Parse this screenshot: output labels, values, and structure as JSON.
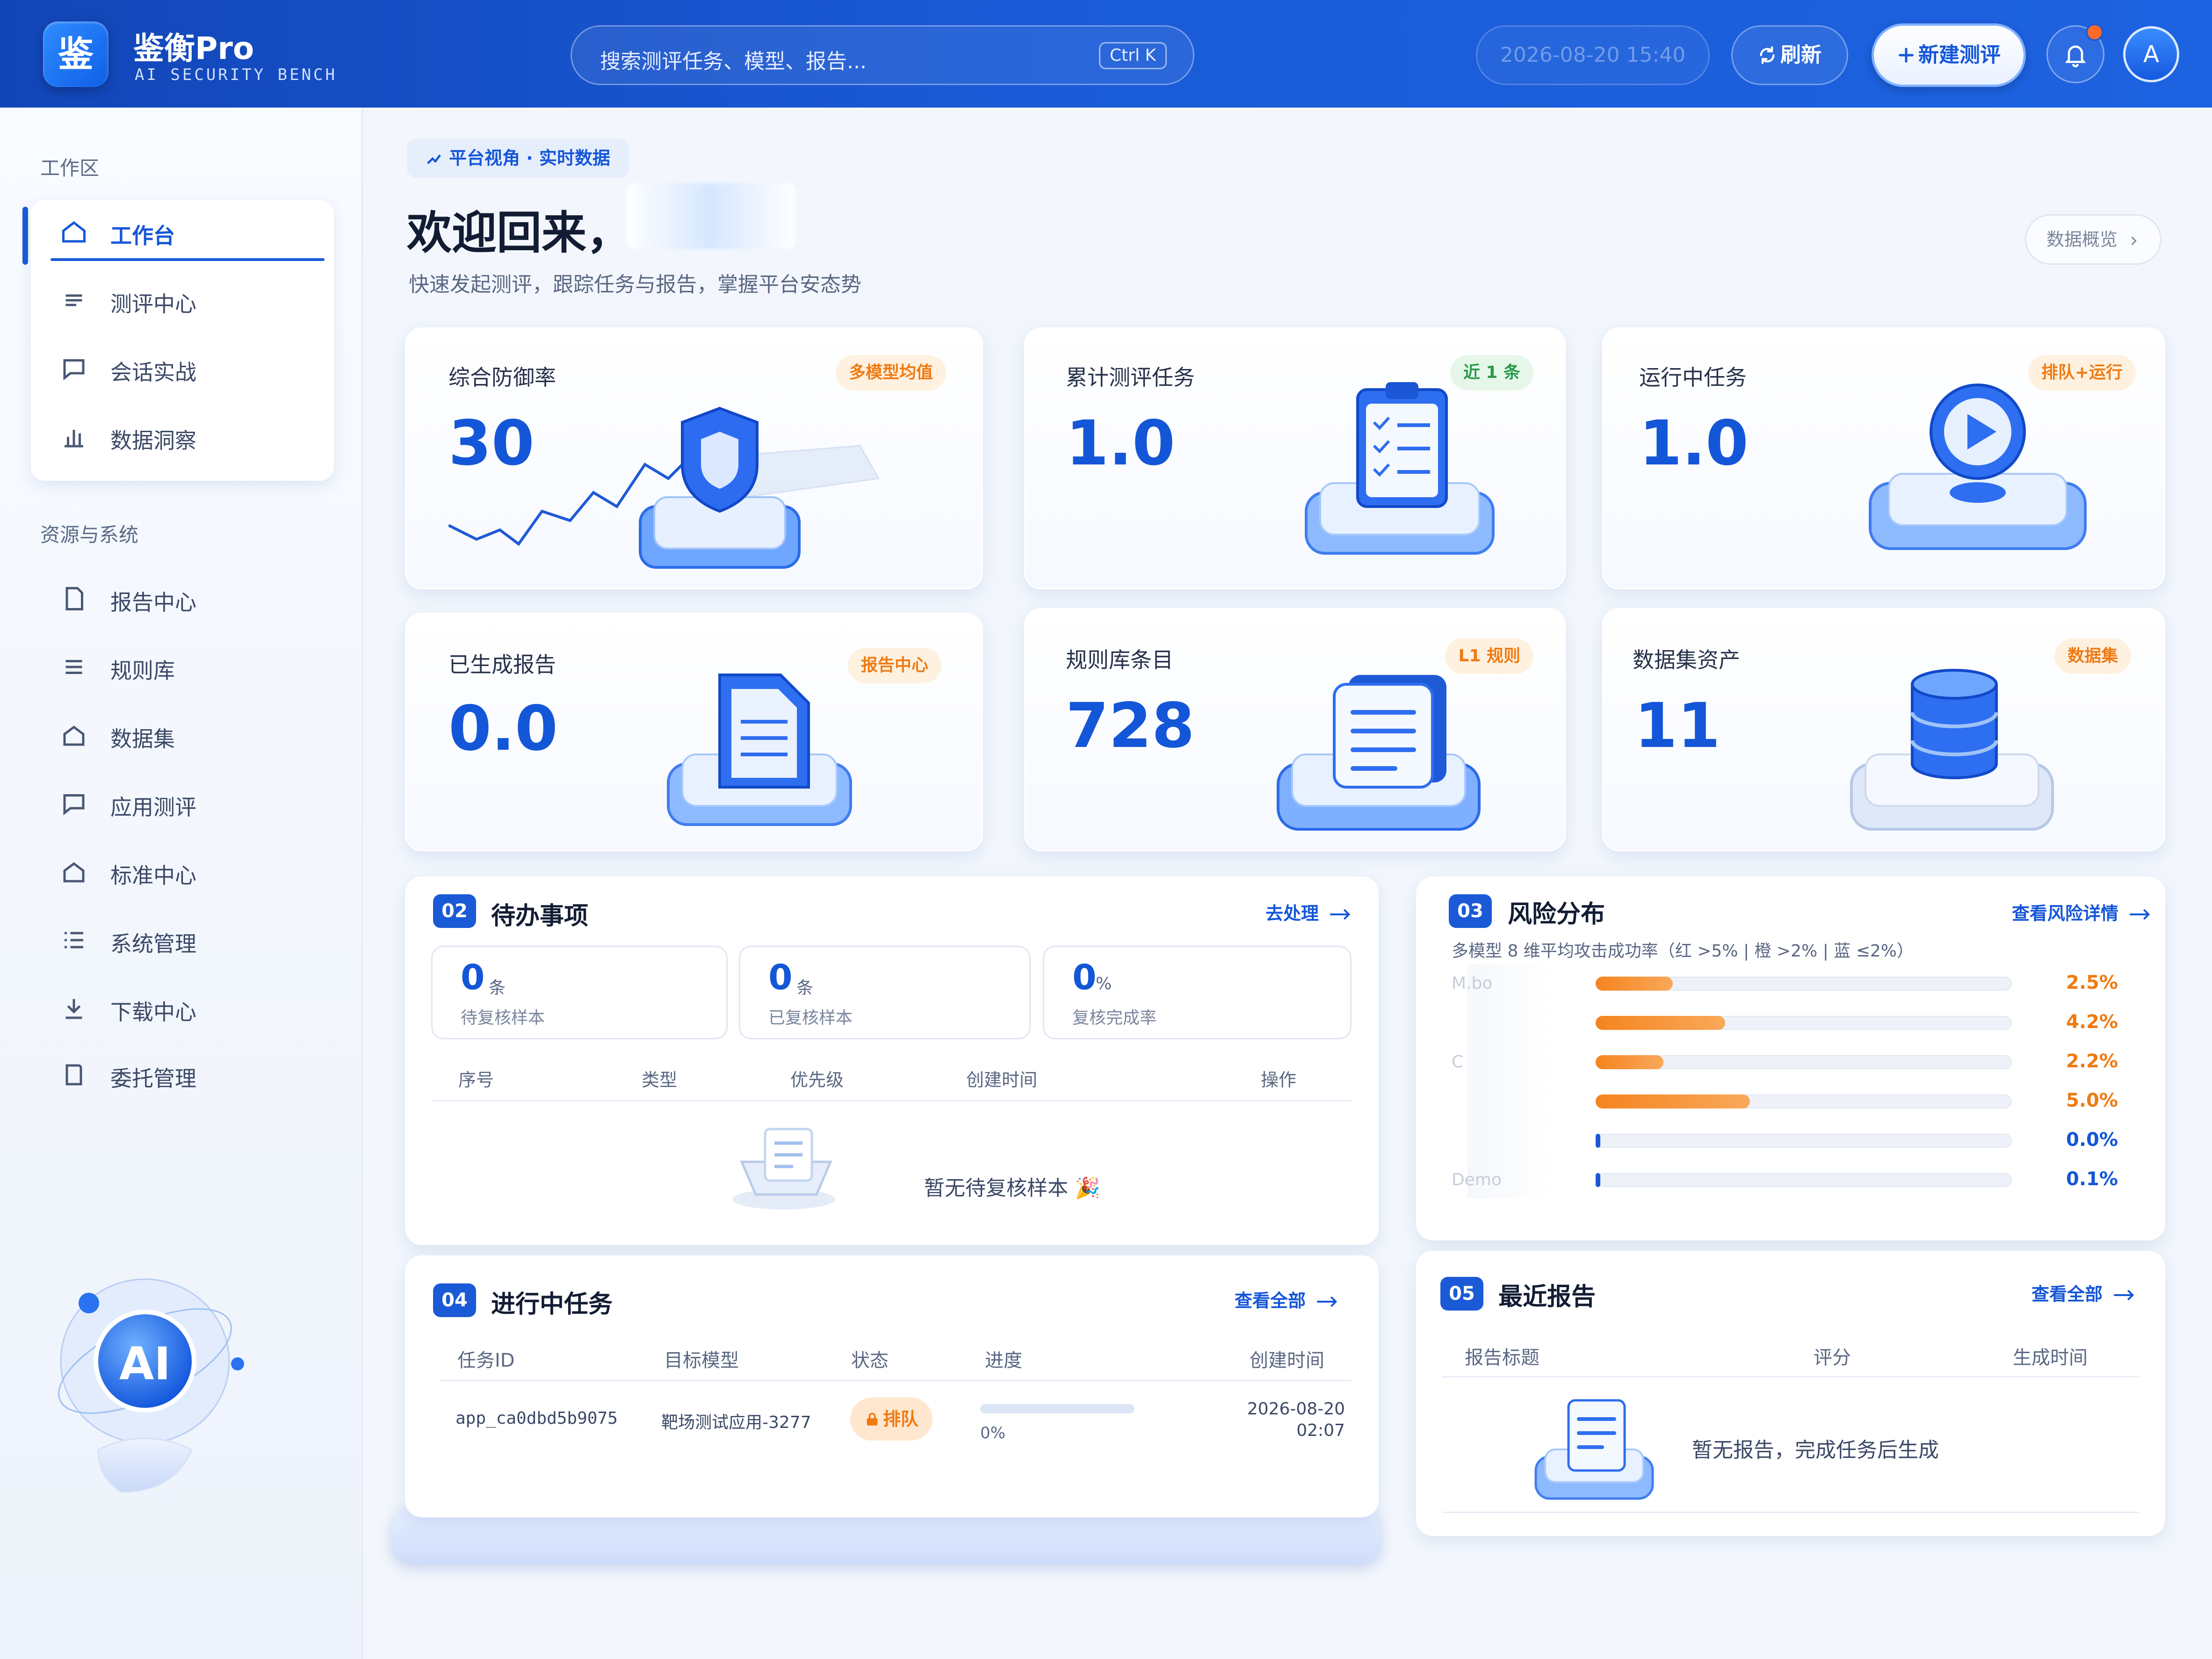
{
  "header": {
    "logo_char": "鉴",
    "brand": "鉴衡Pro",
    "brand_sub": "AI SECURITY BENCH",
    "search_placeholder": "搜索测评任务、模型、报告...",
    "search_shortcut": "Ctrl K",
    "datetime": "2026-08-20  15:40",
    "refresh_label": "刷新",
    "new_eval_label": "新建测评",
    "avatar_letter": "A",
    "notification_dot_color": "#ff6a2b"
  },
  "sidebar": {
    "group1_title": "工作区",
    "group1_items": [
      {
        "label": "工作台",
        "icon": "home-icon",
        "active": true
      },
      {
        "label": "测评中心",
        "icon": "list-icon"
      },
      {
        "label": "会话实战",
        "icon": "chat-icon"
      },
      {
        "label": "数据洞察",
        "icon": "bar-chart-icon"
      }
    ],
    "group2_title": "资源与系统",
    "group2_items": [
      {
        "label": "报告中心",
        "icon": "document-icon"
      },
      {
        "label": "规则库",
        "icon": "list-icon"
      },
      {
        "label": "数据集",
        "icon": "home-icon"
      },
      {
        "label": "应用测评",
        "icon": "chat-icon"
      },
      {
        "label": "标准中心",
        "icon": "home-icon"
      },
      {
        "label": "系统管理",
        "icon": "menu-icon"
      },
      {
        "label": "下载中心",
        "icon": "download-icon"
      },
      {
        "label": "委托管理",
        "icon": "folder-icon"
      }
    ],
    "ai_badge": "AI"
  },
  "main": {
    "badge": "平台视角 · 实时数据",
    "welcome": "欢迎回来，",
    "subtitle": "快速发起测评，跟踪任务与报告，掌握平台安态势",
    "overview_button": "数据概览"
  },
  "stats": [
    {
      "label": "综合防御率",
      "value": "30",
      "tag": "多模型均值",
      "tag_color": "orange",
      "icon": "shield-icon"
    },
    {
      "label": "累计测评任务",
      "value": "1.0",
      "tag": "近 1 条",
      "tag_color": "green",
      "icon": "clipboard-icon"
    },
    {
      "label": "运行中任务",
      "value": "1.0",
      "tag": "排队+运行",
      "tag_color": "orange",
      "icon": "play-icon"
    },
    {
      "label": "已生成报告",
      "value": "0.0",
      "tag": "报告中心",
      "tag_color": "orange",
      "icon": "report-icon"
    },
    {
      "label": "规则库条目",
      "value": "728",
      "tag": "L1 规则",
      "tag_color": "orange",
      "icon": "rules-icon"
    },
    {
      "label": "数据集资产",
      "value": "11",
      "tag": "数据集",
      "tag_color": "orange",
      "icon": "database-icon"
    }
  ],
  "todo": {
    "num": "02",
    "title": "待办事项",
    "link": "去处理",
    "metrics": [
      {
        "value": "0",
        "unit": "条",
        "label": "待复核样本"
      },
      {
        "value": "0",
        "unit": "条",
        "label": "已复核样本"
      },
      {
        "value": "0",
        "unit": "%",
        "label": "复核完成率"
      }
    ],
    "columns": [
      "序号",
      "类型",
      "优先级",
      "创建时间",
      "操作"
    ],
    "empty": "暂无待复核样本 🎉"
  },
  "risk": {
    "num": "03",
    "title": "风险分布",
    "link": "查看风险详情",
    "subtitle": "多模型 8 维平均攻击成功率（红 >5% | 橙 >2% | 蓝 ≤2%）",
    "rows": [
      {
        "name": "M.bo",
        "value": 2.5,
        "label": "2.5%",
        "level": "orange"
      },
      {
        "name": "",
        "value": 4.2,
        "label": "4.2%",
        "level": "orange"
      },
      {
        "name": "C",
        "value": 2.2,
        "label": "2.2%",
        "level": "orange"
      },
      {
        "name": "",
        "value": 5.0,
        "label": "5.0%",
        "level": "orange"
      },
      {
        "name": "",
        "value": 0.0,
        "label": "0.0%",
        "level": "blue"
      },
      {
        "name": "Demo",
        "value": 0.1,
        "label": "0.1%",
        "level": "blue"
      }
    ],
    "colors": {
      "orange": "#f5841f",
      "blue": "#1a5ad6"
    }
  },
  "tasks": {
    "num": "04",
    "title": "进行中任务",
    "link": "查看全部",
    "columns": [
      "任务ID",
      "目标模型",
      "状态",
      "进度",
      "创建时间"
    ],
    "rows": [
      {
        "id": "app_ca0dbd5b9075",
        "model": "靶场测试应用-3277",
        "status": "排队",
        "progress": 0,
        "progress_label": "0%",
        "date": "2026-08-20",
        "time": "02:07"
      }
    ]
  },
  "reports": {
    "num": "05",
    "title": "最近报告",
    "link": "查看全部",
    "columns": [
      "报告标题",
      "评分",
      "生成时间"
    ],
    "empty": "暂无报告，完成任务后生成"
  }
}
